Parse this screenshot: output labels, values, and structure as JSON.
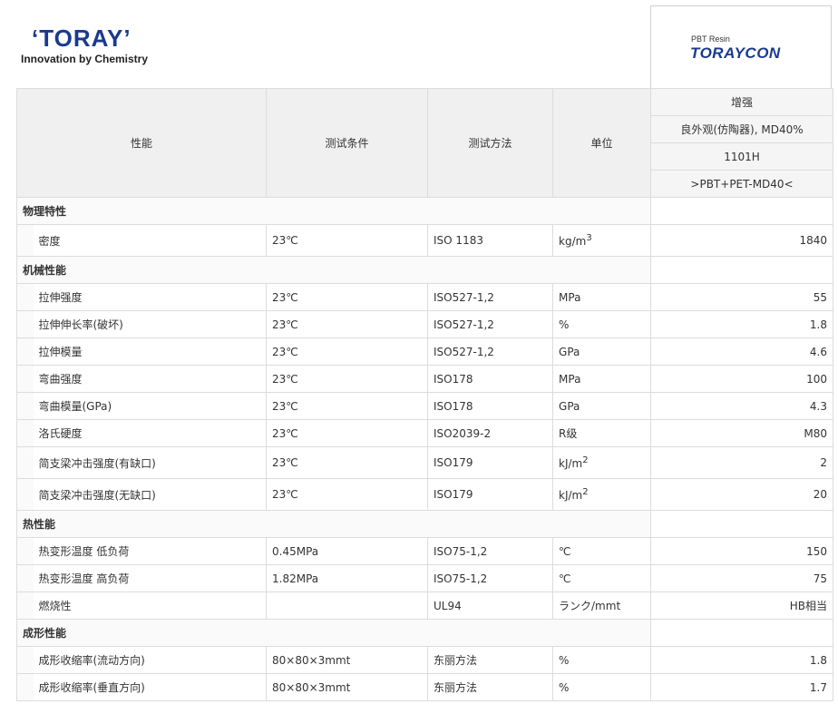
{
  "logo": {
    "brand": "‘TORAY’",
    "tagline": "Innovation by Chemistry"
  },
  "product": {
    "label": "PBT Resin",
    "brand": "TORAYCON"
  },
  "header": {
    "columns": [
      "性能",
      "测试条件",
      "测试方法",
      "单位"
    ],
    "product_lines": [
      "增强",
      "良外观(仿陶器), MD40%",
      "1101H",
      ">PBT+PET-MD40<"
    ]
  },
  "sections": [
    {
      "title": "物理特性",
      "rows": [
        {
          "name": "密度",
          "condition": "23℃",
          "method": "ISO 1183",
          "unit": "kg/m",
          "unit_sup": "3",
          "value": "1840"
        }
      ]
    },
    {
      "title": "机械性能",
      "rows": [
        {
          "name": "拉伸强度",
          "condition": "23℃",
          "method": "ISO527-1,2",
          "unit": "MPa",
          "unit_sup": "",
          "value": "55"
        },
        {
          "name": "拉伸伸长率(破坏)",
          "condition": "23℃",
          "method": "ISO527-1,2",
          "unit": "%",
          "unit_sup": "",
          "value": "1.8"
        },
        {
          "name": "拉伸模量",
          "condition": "23℃",
          "method": "ISO527-1,2",
          "unit": "GPa",
          "unit_sup": "",
          "value": "4.6"
        },
        {
          "name": "弯曲强度",
          "condition": "23℃",
          "method": "ISO178",
          "unit": "MPa",
          "unit_sup": "",
          "value": "100"
        },
        {
          "name": "弯曲模量(GPa)",
          "condition": "23℃",
          "method": "ISO178",
          "unit": "GPa",
          "unit_sup": "",
          "value": "4.3"
        },
        {
          "name": "洛氏硬度",
          "condition": "23℃",
          "method": "ISO2039-2",
          "unit": "R级",
          "unit_sup": "",
          "value": "M80"
        },
        {
          "name": "简支梁冲击强度(有缺口)",
          "condition": "23℃",
          "method": "ISO179",
          "unit": "kJ/m",
          "unit_sup": "2",
          "value": "2"
        },
        {
          "name": "简支梁冲击强度(无缺口)",
          "condition": "23℃",
          "method": "ISO179",
          "unit": "kJ/m",
          "unit_sup": "2",
          "value": "20"
        }
      ]
    },
    {
      "title": "热性能",
      "rows": [
        {
          "name": "热变形温度 低负荷",
          "condition": "0.45MPa",
          "method": "ISO75-1,2",
          "unit": "℃",
          "unit_sup": "",
          "value": "150"
        },
        {
          "name": "热变形温度 高负荷",
          "condition": "1.82MPa",
          "method": "ISO75-1,2",
          "unit": "℃",
          "unit_sup": "",
          "value": "75"
        },
        {
          "name": "燃烧性",
          "condition": "",
          "method": "UL94",
          "unit": "ランク/mmt",
          "unit_sup": "",
          "value": "HB相当"
        }
      ]
    },
    {
      "title": "成形性能",
      "rows": [
        {
          "name": "成形收缩率(流动方向)",
          "condition": "80×80×3mmt",
          "method": "东丽方法",
          "unit": "%",
          "unit_sup": "",
          "value": "1.8"
        },
        {
          "name": "成形收缩率(垂直方向)",
          "condition": "80×80×3mmt",
          "method": "东丽方法",
          "unit": "%",
          "unit_sup": "",
          "value": "1.7"
        }
      ]
    }
  ]
}
